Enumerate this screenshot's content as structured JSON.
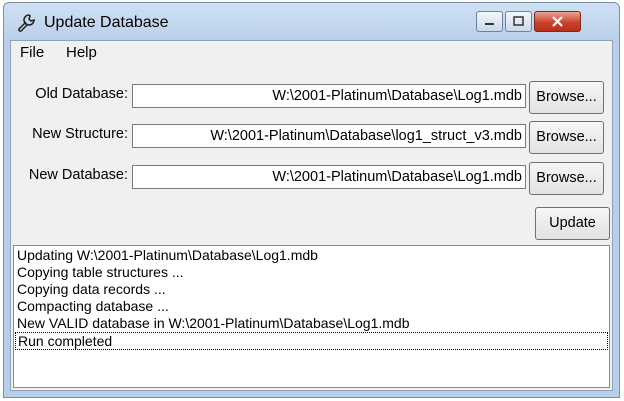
{
  "window": {
    "title": "Update Database"
  },
  "menu": [
    "File",
    "Help"
  ],
  "fields": [
    {
      "label": "Old Database:",
      "value": "W:\\2001-Platinum\\Database\\Log1.mdb",
      "button": "Browse..."
    },
    {
      "label": "New Structure:",
      "value": "W:\\2001-Platinum\\Database\\log1_struct_v3.mdb",
      "button": "Browse..."
    },
    {
      "label": "New Database:",
      "value": "W:\\2001-Platinum\\Database\\Log1.mdb",
      "button": "Browse..."
    }
  ],
  "update_button": "Update",
  "log": [
    "Updating W:\\2001-Platinum\\Database\\Log1.mdb",
    "Copying table structures ...",
    "Copying data records ...",
    "Compacting database ...",
    "New VALID database in W:\\2001-Platinum\\Database\\Log1.mdb",
    "Run completed"
  ],
  "icons": {
    "app": "wrench-icon",
    "minimize": "minimize-icon",
    "maximize": "maximize-icon",
    "close": "close-icon"
  }
}
